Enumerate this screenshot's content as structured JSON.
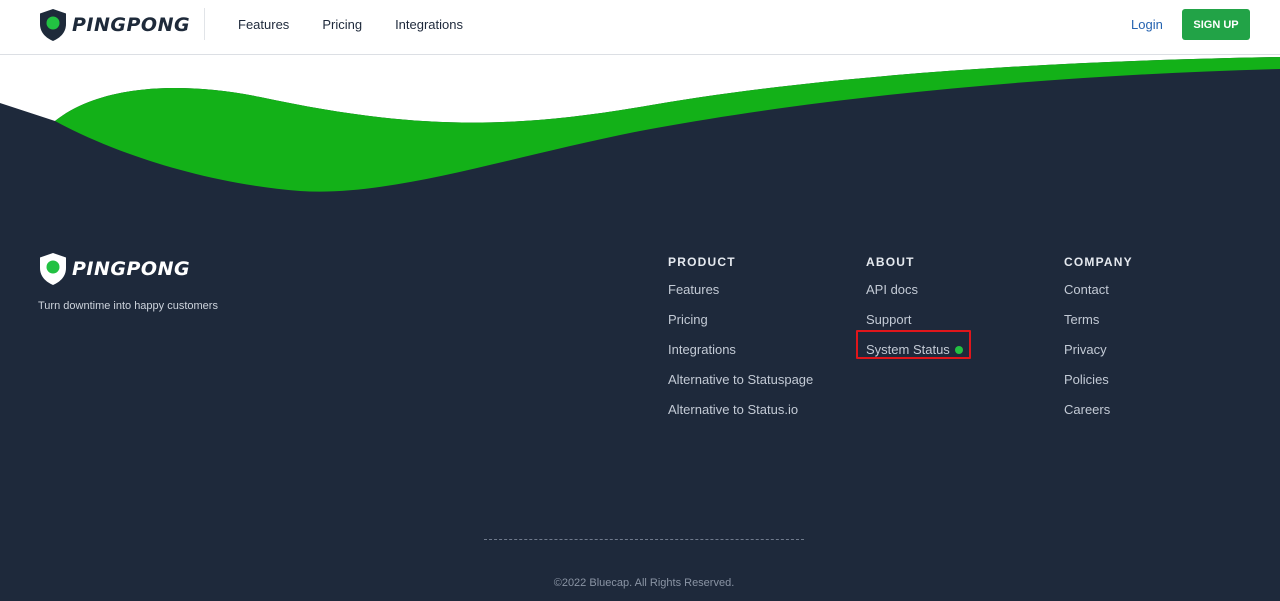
{
  "brand": {
    "name": "PINGPONG",
    "tagline": "Turn downtime into happy customers",
    "accent": "#22a347",
    "dark": "#1e293b"
  },
  "header": {
    "nav": [
      "Features",
      "Pricing",
      "Integrations"
    ],
    "login_label": "Login",
    "signup_label": "SIGN UP"
  },
  "footer": {
    "columns": [
      {
        "title": "PRODUCT",
        "links": [
          "Features",
          "Pricing",
          "Integrations",
          "Alternative to Statuspage",
          "Alternative to Status.io"
        ]
      },
      {
        "title": "ABOUT",
        "links": [
          "API docs",
          "Support",
          "System Status"
        ]
      },
      {
        "title": "COMPANY",
        "links": [
          "Contact",
          "Terms",
          "Privacy",
          "Policies",
          "Careers"
        ]
      }
    ],
    "copyright": "©2022 Bluecap. All Rights Reserved."
  },
  "icons": {
    "logo": "shield-logo-icon",
    "status": "status-dot-icon"
  }
}
